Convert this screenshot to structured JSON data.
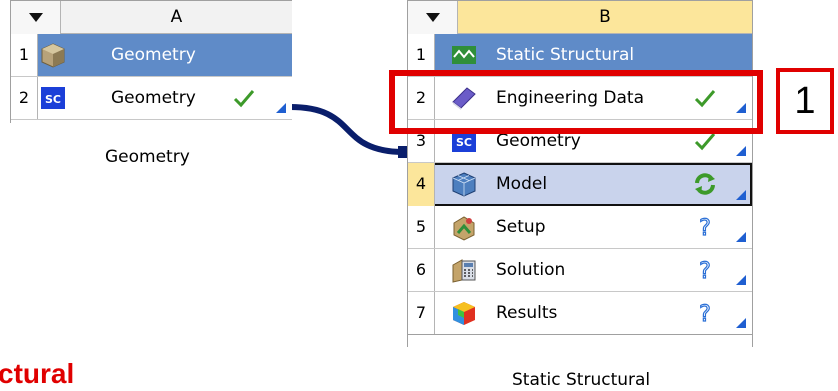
{
  "system_a": {
    "column_letter": "A",
    "caption": "Geometry",
    "rows": [
      {
        "num": "1",
        "label": "Geometry",
        "icon": "geometry-cube-icon",
        "status": "none"
      },
      {
        "num": "2",
        "label": "Geometry",
        "icon": "spaceclaim-sc-icon",
        "status": "check-icon"
      }
    ]
  },
  "system_b": {
    "column_letter": "B",
    "caption": "Static Structural",
    "rows": [
      {
        "num": "1",
        "label": "Static Structural",
        "icon": "static-structural-icon",
        "status": "none"
      },
      {
        "num": "2",
        "label": "Engineering Data",
        "icon": "engineering-data-book-icon",
        "status": "check-icon"
      },
      {
        "num": "3",
        "label": "Geometry",
        "icon": "spaceclaim-sc-icon",
        "status": "check-icon"
      },
      {
        "num": "4",
        "label": "Model",
        "icon": "model-mesh-icon",
        "status": "refresh-icon"
      },
      {
        "num": "5",
        "label": "Setup",
        "icon": "setup-icon",
        "status": "question-icon"
      },
      {
        "num": "6",
        "label": "Solution",
        "icon": "solution-icon",
        "status": "question-icon"
      },
      {
        "num": "7",
        "label": "Results",
        "icon": "results-icon",
        "status": "question-icon"
      }
    ]
  },
  "callout": {
    "number": "1"
  },
  "partial_title": "ctural",
  "colors": {
    "header_selected": "#5f8bc8",
    "header_gold": "#fce69b",
    "selected_row": "#c9d3ec",
    "row4_num": "#fce69b",
    "link_line": "#0a1e6b",
    "callout_red": "#e00000",
    "check_green": "#3d9a2a",
    "corner_blue": "#1f5fd1"
  }
}
